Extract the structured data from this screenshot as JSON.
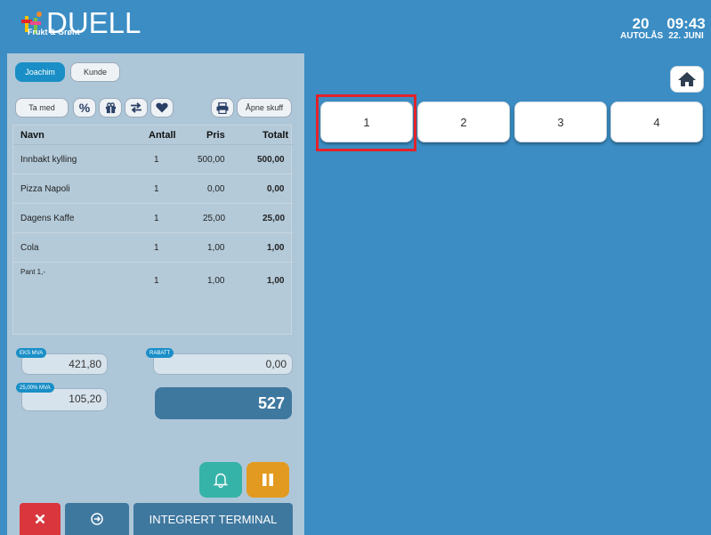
{
  "header": {
    "logo_text": "DUELL",
    "logo_subtitle": "Frukt & Grønt",
    "autolock_value": "20",
    "autolock_label": "AUTOLÅS",
    "time": "09:43",
    "date": "22. JUNI"
  },
  "order": {
    "user_label": "Joachim",
    "customer_label": "Kunde",
    "take_away_label": "Ta med",
    "open_drawer_label": "Åpne skuff",
    "columns": [
      "Navn",
      "Antall",
      "Pris",
      "Totalt"
    ],
    "rows": [
      {
        "name": "Innbakt kylling",
        "qty": "1",
        "price": "500,00",
        "total": "500,00"
      },
      {
        "name": "Pizza Napoli",
        "qty": "1",
        "price": "0,00",
        "total": "0,00"
      },
      {
        "name": "Dagens Kaffe",
        "qty": "1",
        "price": "25,00",
        "total": "25,00"
      },
      {
        "name": "Cola",
        "qty": "1",
        "price": "1,00",
        "total": "1,00"
      },
      {
        "name": "Pant 1,-",
        "qty": "1",
        "price": "1,00",
        "total": "1,00"
      }
    ]
  },
  "totals": {
    "ex_vat_label": "EKS MVA",
    "ex_vat_value": "421,80",
    "discount_label": "RABATT",
    "discount_value": "0,00",
    "vat_label": "25,00% MVA",
    "vat_value": "105,20",
    "grand_total": "527"
  },
  "actions": {
    "terminal_label": "INTEGRERT TERMINAL",
    "colors": {
      "red": "#d9363e",
      "blue": "#3f789f",
      "teal": "#36b3a8",
      "orange": "#e39a20"
    }
  },
  "tables": {
    "buttons": [
      "1",
      "2",
      "3",
      "4"
    ]
  },
  "icons": [
    "percent-icon",
    "gift-icon",
    "transfer-icon",
    "heart-icon",
    "print-icon",
    "bell-icon",
    "pause-icon",
    "close-icon",
    "next-icon",
    "home-icon"
  ]
}
